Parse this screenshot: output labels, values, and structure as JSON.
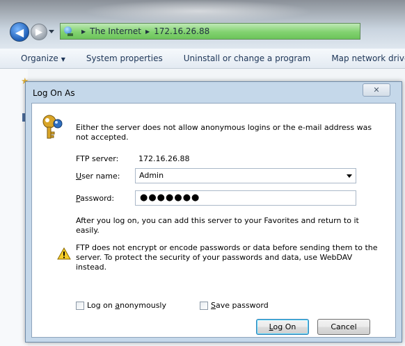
{
  "explorer": {
    "breadcrumb": [
      "The Internet",
      "172.16.26.88"
    ],
    "toolbar": [
      "Organize",
      "System properties",
      "Uninstall or change a program",
      "Map network drive"
    ]
  },
  "dialog": {
    "title": "Log On As",
    "close_glyph": "✕",
    "message": "Either the server does not allow anonymous logins or the e-mail address was not accepted.",
    "ftp_server_label": "FTP server:",
    "ftp_server_value": "172.16.26.88",
    "username_label": "User name:",
    "username_value": "Admin",
    "password_label": "Password:",
    "password_value": "●●●●●●●",
    "info_text": "After you log on, you can add this server to your Favorites and return to it easily.",
    "warning_text": "FTP does not encrypt or encode passwords or data before sending them to the server.  To protect the security of your passwords and data, use WebDAV instead.",
    "log_on_anon_label": "Log on anonymously",
    "save_password_label": "Save password",
    "log_on_button": "Log On",
    "cancel_button": "Cancel"
  },
  "colors": {
    "address_bar": "#82d270",
    "dialog_frame": "#c5d8ea",
    "default_button_border": "#3c7fb1"
  }
}
